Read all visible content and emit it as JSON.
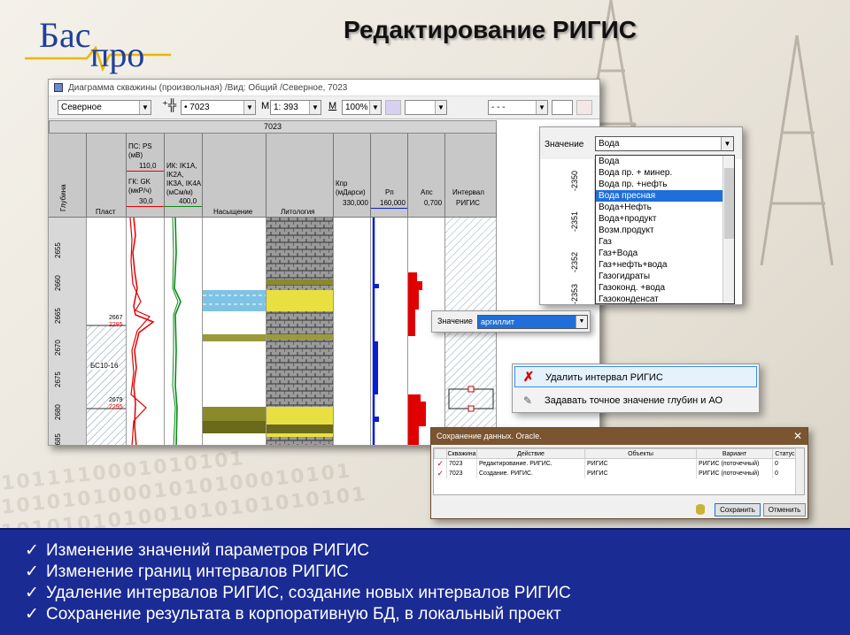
{
  "slide": {
    "title": "Редактирование РИГИС",
    "logo": {
      "part1": "Бас",
      "part2": "про"
    },
    "background_binary": [
      "1011110001010101",
      "10101010001010100010101",
      "101010101001010101010101"
    ],
    "bullets": [
      "Изменение значений параметров РИГИС",
      "Изменение границ интервалов РИГИС",
      "Удаление интервалов РИГИС, создание новых интервалов РИГИС",
      "Сохранение результата в корпоративную БД, в локальный проект"
    ],
    "bullet_mark": "✓"
  },
  "diagram_window": {
    "title": "Диаграмма скважины (произвольная) /Вид: Общий /Северное, 7023",
    "toolbar": {
      "field_combo": "Северное",
      "well_combo": "• 7023",
      "scale_label": "M",
      "scale_combo": "1: 393",
      "zoom_label": "M",
      "zoom_combo": "100%",
      "line_style_combo": "- - -"
    },
    "well_name": "7023",
    "columns": {
      "depth": "Глубина",
      "layer": "Пласт",
      "ps_gk": {
        "l1": "ПС: PS",
        "l2": "(мВ)",
        "l3": "110,0",
        "l4": "ГК: GK",
        "l5": "(мкР/ч)",
        "l6": "30,0"
      },
      "ik": {
        "l1": "ИК: IK1A,",
        "l2": "IK2A,",
        "l3": "IK3A, IK4A",
        "l4": "(мСм/м)",
        "l5": "400,0"
      },
      "saturation": "Насыщение",
      "lithology": "Литология",
      "kpr": {
        "l1": "Кпр",
        "l2": "(мДарси)",
        "l3": "330,000"
      },
      "rp": {
        "l1": "Рп",
        "l2": "160,000"
      },
      "aps": {
        "l1": "Апс",
        "l2": "0,700"
      },
      "rigis": {
        "l1": "Интервал",
        "l2": "РИГИС"
      }
    },
    "depth_ticks": [
      "2655",
      "2660",
      "2665",
      "2670",
      "2675",
      "2680",
      "2685"
    ],
    "layer_marks": [
      {
        "depth": "2667",
        "abs": "2285"
      },
      {
        "depth": "2679",
        "abs": "2295"
      }
    ],
    "layer_name": "БС10-16"
  },
  "value_dropdown": {
    "label": "Значение",
    "selected": "Вода",
    "ruler_ticks": [
      "-2350",
      "-2351",
      "-2352",
      "-2353"
    ],
    "options": [
      "Вода",
      "Вода пр. + минер.",
      "Вода пр. +нефть",
      "Вода пресная",
      "Вода+Нефть",
      "Вода+продукт",
      "Возм.продукт",
      "Газ",
      "Газ+Вода",
      "Газ+нефть+вода",
      "Газогидраты",
      "Газоконд. +вода",
      "Газоконденсат"
    ],
    "highlighted_option": "Вода пресная"
  },
  "litho_value": {
    "label": "Значение",
    "selected": "аргиллит"
  },
  "context_menu": {
    "items": [
      {
        "label": "Удалить интервал РИГИС",
        "icon": "delete-x-icon"
      },
      {
        "label": "Задавать точное значение глубин и АО",
        "icon": "pencil-icon"
      }
    ]
  },
  "save_dialog": {
    "title": "Сохранение данных. Oracle.",
    "close": "✕",
    "headers": [
      "Скважина",
      "Действие",
      "Объекты",
      "Вариант",
      "Статус"
    ],
    "rows": [
      [
        "7023",
        "Редактирование. РИГИС.",
        "РИГИС",
        "РИГИС (поточечный)",
        "0"
      ],
      [
        "7023",
        "Создание. РИГИС.",
        "РИГИС",
        "РИГИС (поточечный)",
        "0"
      ]
    ],
    "save_button": "Сохранить",
    "cancel_button": "Отменить"
  },
  "colors": {
    "panel_blue": "#1b2b94",
    "selection_blue": "#1e6fd9",
    "logo_blue": "#1f3f9a",
    "curve_red": "#e00000",
    "curve_green": "#0a8a1a",
    "curve_blue": "#0a1fd0"
  }
}
